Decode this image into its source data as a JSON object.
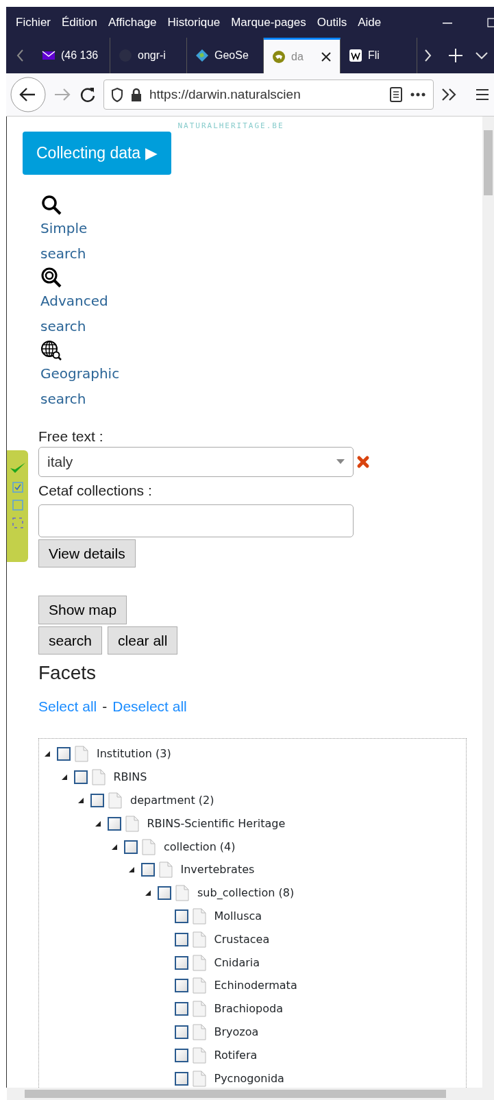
{
  "menu_bar": {
    "items": [
      "Fichier",
      "Édition",
      "Affichage",
      "Historique",
      "Marque-pages",
      "Outils",
      "Aide"
    ]
  },
  "tabs": [
    {
      "label": "(46 136",
      "selected": false,
      "kind": "mail"
    },
    {
      "label": "ongr-i",
      "selected": false,
      "kind": "github"
    },
    {
      "label": "GeoSe",
      "selected": false,
      "kind": "globe"
    },
    {
      "label": "da",
      "selected": true,
      "kind": "dino"
    },
    {
      "label": "Fli",
      "selected": false,
      "kind": "wiki"
    }
  ],
  "address_bar": {
    "url": "https://darwin.naturalscien"
  },
  "site_logo": {
    "text": "NATURALHERITAGE.BE"
  },
  "collecting_button": {
    "label": "Collecting data ▶"
  },
  "search_links": [
    {
      "kind": "simple",
      "label": "Simple search"
    },
    {
      "kind": "advanced",
      "label": "Advanced search"
    },
    {
      "kind": "geographic",
      "label": "Geographic search"
    }
  ],
  "free_text": {
    "label": "Free text :",
    "value": "italy"
  },
  "cetaf": {
    "label": "Cetaf collections :"
  },
  "buttons": {
    "view_details": "View details",
    "show_map": "Show map",
    "search": "search",
    "clear_all": "clear all"
  },
  "facets": {
    "title": "Facets",
    "select_all": "Select all",
    "separator": "-",
    "deselect_all": "Deselect all",
    "tree": [
      {
        "label": "Institution (3)",
        "expanded": true,
        "checked": false,
        "children": [
          {
            "label": "RBINS",
            "expanded": true,
            "checked": false,
            "children": [
              {
                "label": "department (2)",
                "expanded": true,
                "checked": false,
                "children": [
                  {
                    "label": "RBINS-Scientific Heritage",
                    "expanded": true,
                    "checked": false,
                    "children": [
                      {
                        "label": "collection (4)",
                        "expanded": true,
                        "checked": false,
                        "children": [
                          {
                            "label": "Invertebrates",
                            "expanded": true,
                            "checked": false,
                            "children": [
                              {
                                "label": "sub_collection (8)",
                                "expanded": true,
                                "checked": false,
                                "children": [
                                  {
                                    "label": "Mollusca",
                                    "checked": false
                                  },
                                  {
                                    "label": "Crustacea",
                                    "checked": false
                                  },
                                  {
                                    "label": "Cnidaria",
                                    "checked": false
                                  },
                                  {
                                    "label": "Echinodermata",
                                    "checked": false
                                  },
                                  {
                                    "label": "Brachiopoda",
                                    "checked": false
                                  },
                                  {
                                    "label": "Bryozoa",
                                    "checked": false
                                  },
                                  {
                                    "label": "Rotifera",
                                    "checked": false
                                  },
                                  {
                                    "label": "Pycnogonida",
                                    "checked": false
                                  }
                                ]
                              }
                            ]
                          }
                        ]
                      }
                    ]
                  }
                ]
              }
            ]
          }
        ]
      }
    ]
  }
}
